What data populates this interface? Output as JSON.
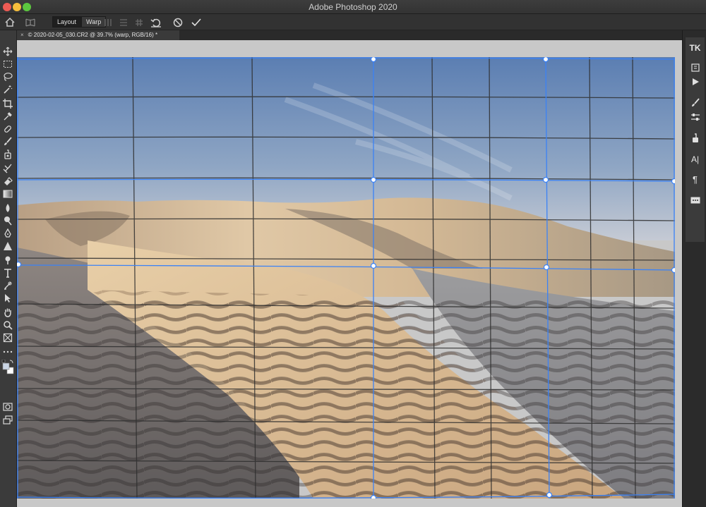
{
  "window": {
    "title": "Adobe Photoshop 2020"
  },
  "options_bar": {
    "home_icon": "home-icon",
    "warp_mode_icon": "warp-mode-icon",
    "layout_label": "Layout",
    "warp_label": "Warp",
    "buttons": [
      "split-vertical-icon",
      "split-horizontal-icon",
      "split-crosswise-icon",
      "reset-warp-icon",
      "cancel-icon",
      "commit-icon"
    ]
  },
  "document_tab": {
    "close": "×",
    "title": "© 2020-02-05_030.CR2 @ 39.7% (warp, RGB/16) *"
  },
  "right_panel": {
    "tk_label": "TK",
    "character_label": "A|",
    "paragraph_label": "¶"
  },
  "colors": {
    "accent": "#3b82f6",
    "app_bg": "#282828",
    "panel_bg": "#3b3b3b",
    "canvas_bg": "#c8c8c8"
  }
}
